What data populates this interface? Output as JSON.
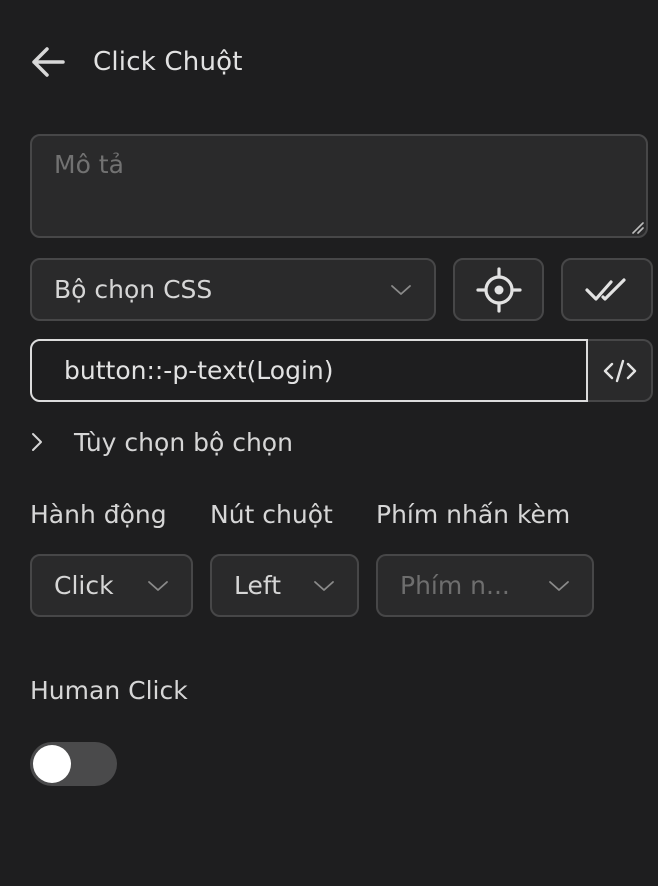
{
  "header": {
    "title": "Click Chuột",
    "back_icon": "arrow-left-icon"
  },
  "description": {
    "placeholder": "Mô tả",
    "value": ""
  },
  "selector": {
    "type_value": "Bộ chọn CSS",
    "input_value": "button::-p-text(Login)",
    "options_label": "Tùy chọn bộ chọn",
    "icons": {
      "target": "crosshair-icon",
      "check": "double-check-icon",
      "code": "code-icon",
      "expand": "chevron-right-icon"
    }
  },
  "fields": {
    "action_label": "Hành động",
    "action_value": "Click",
    "mouse_button_label": "Nút chuột",
    "mouse_button_value": "Left",
    "modifier_label": "Phím nhấn kèm",
    "modifier_placeholder": "Phím n..."
  },
  "human_click": {
    "label": "Human Click",
    "enabled": false
  },
  "colors": {
    "background": "#1e1e1f",
    "surface": "#2a2a2b",
    "border": "#474748",
    "focus_border": "#dcdcdc",
    "text": "#d6d6d6",
    "placeholder": "#727272",
    "toggle_track": "#4a4a4b"
  }
}
